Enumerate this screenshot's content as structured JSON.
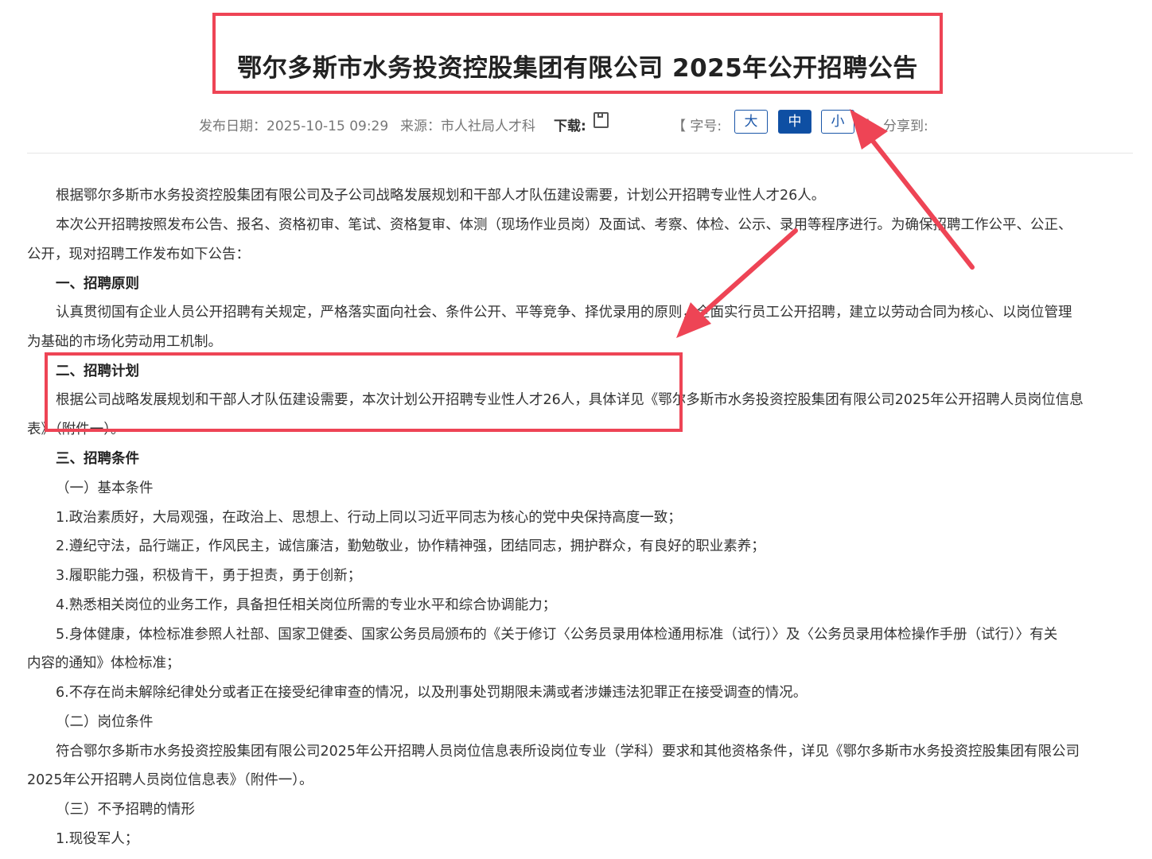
{
  "header": {
    "title": "鄂尔多斯市水务投资控股集团有限公司 2025年公开招聘公告"
  },
  "meta": {
    "date_label": "发布日期：2025-10-15 09:29",
    "source_label": "来源：市人社局人才科",
    "download_label": "下载:",
    "font_size_label": "【 字号:",
    "font_sizes": [
      "大",
      "中",
      "小"
    ],
    "bracket_close": "】",
    "share_label": "分享到:",
    "save_icon": "save-icon"
  },
  "content": {
    "lines": [
      "根据鄂尔多斯市水务投资控股集团有限公司及子公司战略发展规划和干部人才队伍建设需要，计划公开招聘专业性人才26人。",
      "本次公开招聘按照发布公告、报名、资格初审、笔试、资格复审、体测（现场作业员岗）及面试、考察、体检、公示、录用等程序进行。为确保招聘工作公平、公正、",
      "公开，现对招聘工作发布如下公告：",
      "一、招聘原则",
      "认真贯彻国有企业人员公开招聘有关规定，严格落实面向社会、条件公开、平等竞争、择优录用的原则，全面实行员工公开招聘，建立以劳动合同为核心、以岗位管理",
      "为基础的市场化劳动用工机制。",
      "二、招聘计划",
      "根据公司战略发展规划和干部人才队伍建设需要，本次计划公开招聘专业性人才26人，具体详见《鄂尔多斯市水务投资控股集团有限公司2025年公开招聘人员岗位信息",
      "表》（附件一）。",
      "三、招聘条件",
      "（一）基本条件",
      "1.政治素质好，大局观强，在政治上、思想上、行动上同以习近平同志为核心的党中央保持高度一致；",
      "2.遵纪守法，品行端正，作风民主，诚信廉洁，勤勉敬业，协作精神强，团结同志，拥护群众，有良好的职业素养；",
      "3.履职能力强，积极肯干，勇于担责，勇于创新；",
      "4.熟悉相关岗位的业务工作，具备担任相关岗位所需的专业水平和综合协调能力；",
      "5.身体健康，体检标准参照人社部、国家卫健委、国家公务员局颁布的《关于修订〈公务员录用体检通用标准（试行）〉及〈公务员录用体检操作手册（试行）〉有关",
      "内容的通知》体检标准；",
      "6.不存在尚未解除纪律处分或者正在接受纪律审查的情况，以及刑事处罚期限未满或者涉嫌违法犯罪正在接受调查的情况。",
      "（二）岗位条件",
      "符合鄂尔多斯市水务投资控股集团有限公司2025年公开招聘人员岗位信息表所设岗位专业（学科）要求和其他资格条件，详见《鄂尔多斯市水务投资控股集团有限公司",
      "2025年公开招聘人员岗位信息表》（附件一）。",
      "（三）不予招聘的情形",
      "1.现役军人；"
    ]
  },
  "colors": {
    "annotation_red": "#ee4455",
    "active_blue": "#0e4fa3"
  }
}
